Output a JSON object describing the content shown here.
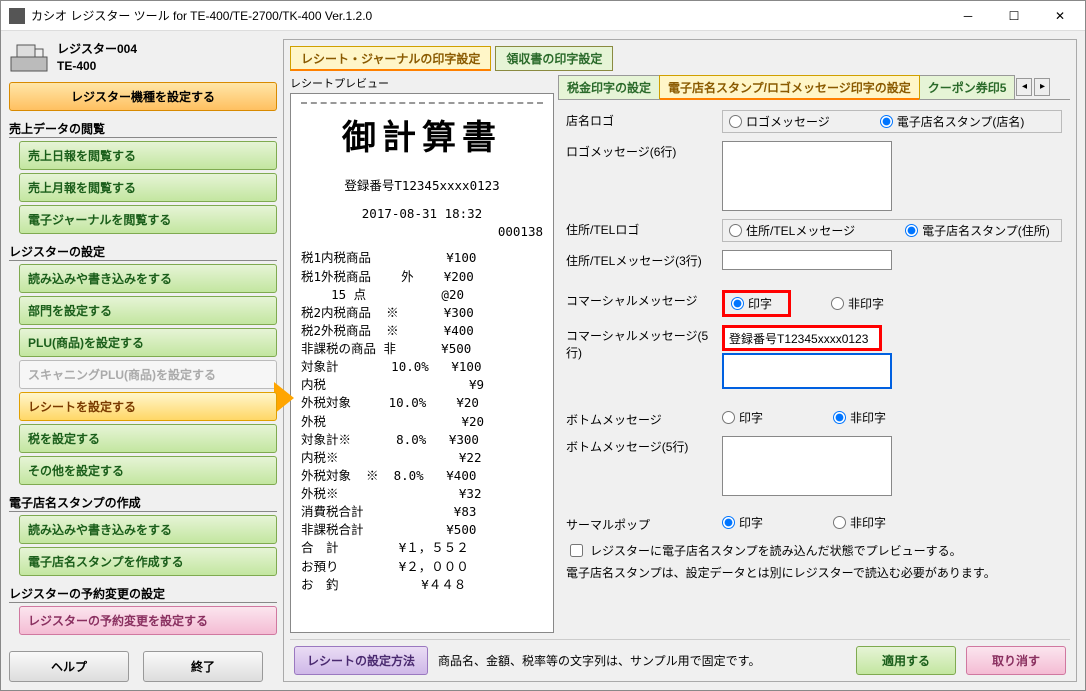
{
  "window": {
    "title": "カシオ レジスター ツール for TE-400/TE-2700/TK-400 Ver.1.2.0"
  },
  "register": {
    "name": "レジスター004",
    "model": "TE-400"
  },
  "sidebar": {
    "set_model": "レジスター機種を設定する",
    "sec_sales": "売上データの閲覧",
    "sales": [
      "売上日報を閲覧する",
      "売上月報を閲覧する",
      "電子ジャーナルを閲覧する"
    ],
    "sec_settings": "レジスターの設定",
    "settings": [
      "読み込みや書き込みをする",
      "部門を設定する",
      "PLU(商品)を設定する",
      "スキャニングPLU(商品)を設定する",
      "レシートを設定する",
      "税を設定する",
      "その他を設定する"
    ],
    "sec_stamp": "電子店名スタンプの作成",
    "stamp": [
      "読み込みや書き込みをする",
      "電子店名スタンプを作成する"
    ],
    "sec_reserve": "レジスターの予約変更の設定",
    "reserve": "レジスターの予約変更を設定する",
    "help": "ヘルプ",
    "exit": "終了"
  },
  "top_tabs": {
    "t1": "レシート・ジャーナルの印字設定",
    "t2": "領収書の印字設定"
  },
  "preview_label": "レシートプレビュー",
  "receipt": {
    "title": "御計算書",
    "reg_no": "登録番号T12345xxxx0123",
    "datetime": "2017-08-31 18:32",
    "serial": "000138",
    "lines": [
      "税1内税商品          ¥100",
      "税1外税商品    外    ¥200",
      "    15 点          @20",
      "税2内税商品  ※      ¥300",
      "税2外税商品  ※      ¥400",
      "非課税の商品 非      ¥500",
      "対象計       10.0%   ¥100",
      "内税                   ¥9",
      "外税対象     10.0%    ¥20",
      "外税                  ¥20",
      "対象計※      8.0%   ¥300",
      "内税※                ¥22",
      "外税対象  ※  8.0%   ¥400",
      "外税※                ¥32",
      "消費税合計            ¥83",
      "非課税合計           ¥500",
      "合　計        ¥１，５５２",
      "お預り        ¥２，０００",
      "お　釣           ¥４４８"
    ]
  },
  "sub_tabs": {
    "t1": "税金印字の設定",
    "t2": "電子店名スタンプ/ロゴメッセージ印字の設定",
    "t3": "クーポン券印5"
  },
  "fields": {
    "shop_logo": "店名ロゴ",
    "logo_msg": "ロゴメッセージ",
    "stamp_shop": "電子店名スタンプ(店名)",
    "logo_msg6": "ロゴメッセージ(6行)",
    "addr_logo": "住所/TELロゴ",
    "addr_msg": "住所/TELメッセージ",
    "stamp_addr": "電子店名スタンプ(住所)",
    "addr_msg3": "住所/TELメッセージ(3行)",
    "commercial": "コマーシャルメッセージ",
    "print": "印字",
    "noprint": "非印字",
    "commercial5": "コマーシャルメッセージ(5行)",
    "commercial_val": "登録番号T12345xxxx0123",
    "bottom": "ボトムメッセージ",
    "bottom5": "ボトムメッセージ(5行)",
    "thermal": "サーマルポップ",
    "check_preview": "レジスターに電子店名スタンプを読み込んだ状態でプレビューする。",
    "note": "電子店名スタンプは、設定データとは別にレジスターで読込む必要があります。"
  },
  "footer": {
    "howto": "レシートの設定方法",
    "note": "商品名、金額、税率等の文字列は、サンプル用で固定です。",
    "apply": "適用する",
    "cancel": "取り消す"
  }
}
